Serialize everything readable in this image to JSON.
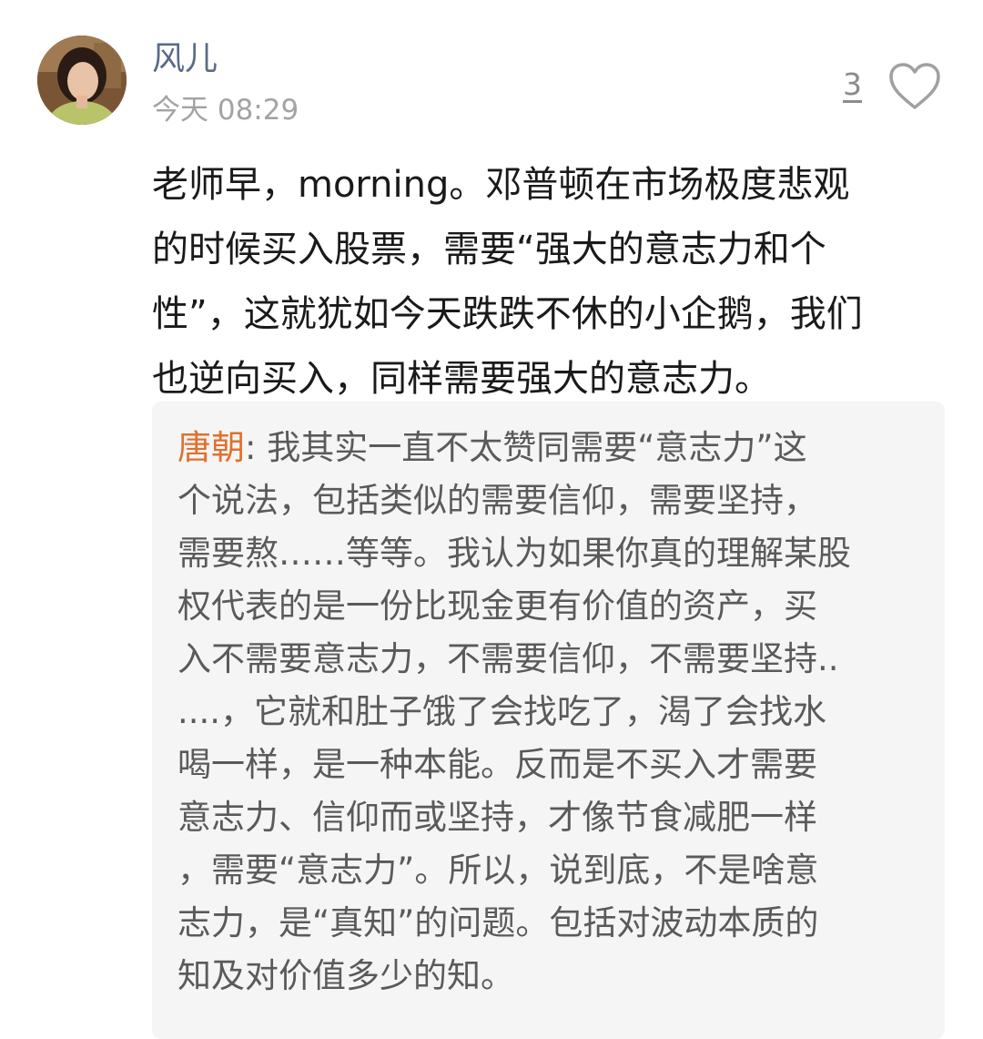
{
  "comment": {
    "username": "风儿",
    "timestamp": "今天 08:29",
    "like_count": "3",
    "text": "老师早，morning。邓普顿在市场极度悲观\n的时候买入股票，需要“强大的意志力和个\n性”，这就犹如今天跌跌不休的小企鹅，我们\n也逆向买入，同样需要强大的意志力。"
  },
  "reply": {
    "author": "唐朝",
    "separator": ": ",
    "text": "我其实一直不太赞同需要“意志力”这\n个说法，包括类似的需要信仰，需要坚持，\n需要熬……等等。我认为如果你真的理解某股\n权代表的是一份比现金更有价值的资产，买\n入不需要意志力，不需要信仰，不需要坚持..\n....，它就和肚子饿了会找吃了，渴了会找水\n喝一样，是一种本能。反而是不买入才需要\n意志力、信仰而或坚持，才像节食减肥一样\n，需要“意志力”。所以，说到底，不是啥意\n志力，是“真知”的问题。包括对波动本质的\n知及对价值多少的知。"
  },
  "icons": {
    "avatar": "user-avatar-photo",
    "like": "heart-outline-icon"
  },
  "colors": {
    "username": "#5a6b88",
    "reply_author": "#e0702d",
    "reply_background": "#f5f5f5"
  }
}
